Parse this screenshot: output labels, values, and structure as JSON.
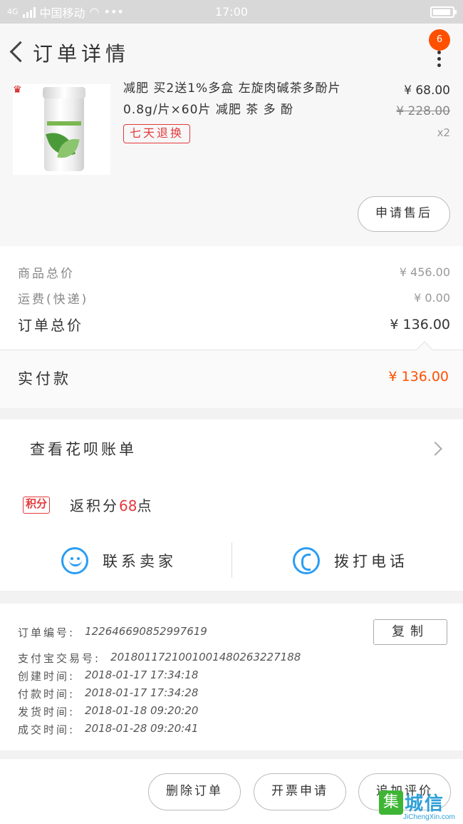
{
  "status_bar": {
    "network": "4G",
    "carrier": "中国移动",
    "dots": "•••",
    "time": "17:00"
  },
  "header": {
    "title": "订单详情",
    "badge_count": "6"
  },
  "product": {
    "name_line1": "减肥 买2送1%多盒 左旋肉碱茶多酚片",
    "name_line2": "0.8g/片×60片 减肥 茶 多 酚",
    "tag": "七天退换",
    "price": "¥ 68.00",
    "original_price": "¥ 228.00",
    "quantity": "x2",
    "after_sale_button": "申请售后"
  },
  "summary": {
    "goods_total_label": "商品总价",
    "goods_total_value": "¥ 456.00",
    "shipping_label": "运费(快递)",
    "shipping_value": "¥ 0.00",
    "order_total_label": "订单总价",
    "order_total_value": "¥ 136.00",
    "paid_label": "实付款",
    "paid_value": "¥ 136.00"
  },
  "huabei": {
    "label": "查看花呗账单"
  },
  "points": {
    "tag": "积分",
    "text_prefix": "返积分",
    "number": "68",
    "text_suffix": "点"
  },
  "contact": {
    "seller": "联系卖家",
    "call": "拨打电话"
  },
  "order_info": {
    "rows": [
      {
        "k": "订单编号:",
        "v": "122646690852997619"
      },
      {
        "k": "支付宝交易号:",
        "v": "2018011721001001480263227188"
      },
      {
        "k": "创建时间:",
        "v": "2018-01-17 17:34:18"
      },
      {
        "k": "付款时间:",
        "v": "2018-01-17 17:34:28"
      },
      {
        "k": "发货时间:",
        "v": "2018-01-18 09:20:20"
      },
      {
        "k": "成交时间:",
        "v": "2018-01-28 09:20:41"
      }
    ],
    "copy_button": "复制"
  },
  "actions": {
    "delete": "删除订单",
    "invoice": "开票申请",
    "review": "追加评价"
  },
  "watermark": {
    "mark": "集",
    "text": "城信",
    "url": "JiChengXin.com"
  },
  "colors": {
    "accent_orange": "#ff5000",
    "tag_red": "#e4393c",
    "icon_blue": "#2a9df4"
  }
}
